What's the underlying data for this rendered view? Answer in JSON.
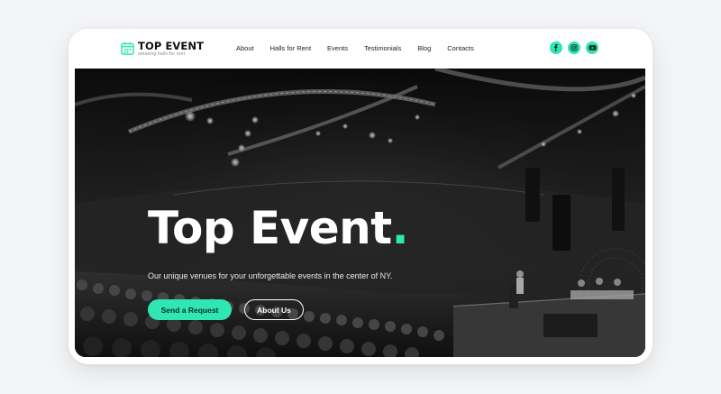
{
  "brand": {
    "name": "TOP EVENT",
    "tagline": "amazing halls for rent",
    "accent": "#2fe6b4"
  },
  "nav": {
    "items": [
      {
        "label": "About"
      },
      {
        "label": "Halls for Rent"
      },
      {
        "label": "Events"
      },
      {
        "label": "Testimonials"
      },
      {
        "label": "Blog"
      },
      {
        "label": "Contacts"
      }
    ],
    "social": [
      "facebook-icon",
      "instagram-icon",
      "youtube-icon"
    ]
  },
  "hero": {
    "title": "Top Event",
    "title_dot": ".",
    "subtitle": "Our unique venues for your unforgettable events in the center of NY.",
    "primary_button": "Send a Request",
    "secondary_button": "About Us"
  }
}
